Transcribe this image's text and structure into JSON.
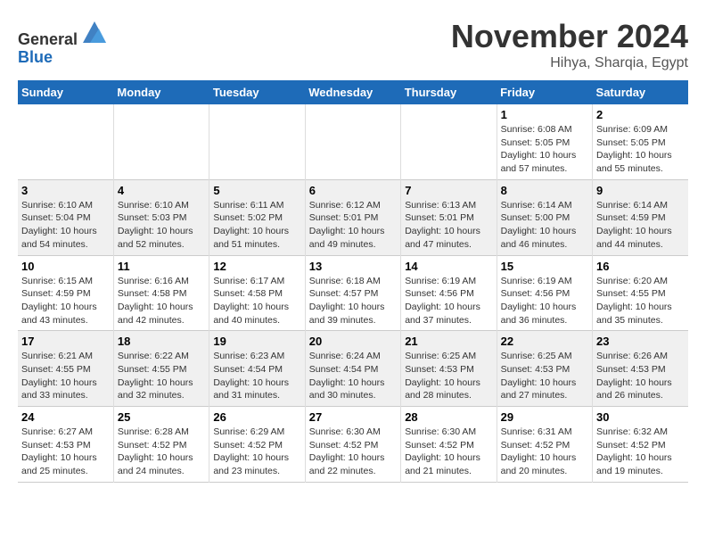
{
  "header": {
    "logo_line1": "General",
    "logo_line2": "Blue",
    "month": "November 2024",
    "location": "Hihya, Sharqia, Egypt"
  },
  "weekdays": [
    "Sunday",
    "Monday",
    "Tuesday",
    "Wednesday",
    "Thursday",
    "Friday",
    "Saturday"
  ],
  "weeks": [
    [
      {
        "day": "",
        "info": ""
      },
      {
        "day": "",
        "info": ""
      },
      {
        "day": "",
        "info": ""
      },
      {
        "day": "",
        "info": ""
      },
      {
        "day": "",
        "info": ""
      },
      {
        "day": "1",
        "info": "Sunrise: 6:08 AM\nSunset: 5:05 PM\nDaylight: 10 hours and 57 minutes."
      },
      {
        "day": "2",
        "info": "Sunrise: 6:09 AM\nSunset: 5:05 PM\nDaylight: 10 hours and 55 minutes."
      }
    ],
    [
      {
        "day": "3",
        "info": "Sunrise: 6:10 AM\nSunset: 5:04 PM\nDaylight: 10 hours and 54 minutes."
      },
      {
        "day": "4",
        "info": "Sunrise: 6:10 AM\nSunset: 5:03 PM\nDaylight: 10 hours and 52 minutes."
      },
      {
        "day": "5",
        "info": "Sunrise: 6:11 AM\nSunset: 5:02 PM\nDaylight: 10 hours and 51 minutes."
      },
      {
        "day": "6",
        "info": "Sunrise: 6:12 AM\nSunset: 5:01 PM\nDaylight: 10 hours and 49 minutes."
      },
      {
        "day": "7",
        "info": "Sunrise: 6:13 AM\nSunset: 5:01 PM\nDaylight: 10 hours and 47 minutes."
      },
      {
        "day": "8",
        "info": "Sunrise: 6:14 AM\nSunset: 5:00 PM\nDaylight: 10 hours and 46 minutes."
      },
      {
        "day": "9",
        "info": "Sunrise: 6:14 AM\nSunset: 4:59 PM\nDaylight: 10 hours and 44 minutes."
      }
    ],
    [
      {
        "day": "10",
        "info": "Sunrise: 6:15 AM\nSunset: 4:59 PM\nDaylight: 10 hours and 43 minutes."
      },
      {
        "day": "11",
        "info": "Sunrise: 6:16 AM\nSunset: 4:58 PM\nDaylight: 10 hours and 42 minutes."
      },
      {
        "day": "12",
        "info": "Sunrise: 6:17 AM\nSunset: 4:58 PM\nDaylight: 10 hours and 40 minutes."
      },
      {
        "day": "13",
        "info": "Sunrise: 6:18 AM\nSunset: 4:57 PM\nDaylight: 10 hours and 39 minutes."
      },
      {
        "day": "14",
        "info": "Sunrise: 6:19 AM\nSunset: 4:56 PM\nDaylight: 10 hours and 37 minutes."
      },
      {
        "day": "15",
        "info": "Sunrise: 6:19 AM\nSunset: 4:56 PM\nDaylight: 10 hours and 36 minutes."
      },
      {
        "day": "16",
        "info": "Sunrise: 6:20 AM\nSunset: 4:55 PM\nDaylight: 10 hours and 35 minutes."
      }
    ],
    [
      {
        "day": "17",
        "info": "Sunrise: 6:21 AM\nSunset: 4:55 PM\nDaylight: 10 hours and 33 minutes."
      },
      {
        "day": "18",
        "info": "Sunrise: 6:22 AM\nSunset: 4:55 PM\nDaylight: 10 hours and 32 minutes."
      },
      {
        "day": "19",
        "info": "Sunrise: 6:23 AM\nSunset: 4:54 PM\nDaylight: 10 hours and 31 minutes."
      },
      {
        "day": "20",
        "info": "Sunrise: 6:24 AM\nSunset: 4:54 PM\nDaylight: 10 hours and 30 minutes."
      },
      {
        "day": "21",
        "info": "Sunrise: 6:25 AM\nSunset: 4:53 PM\nDaylight: 10 hours and 28 minutes."
      },
      {
        "day": "22",
        "info": "Sunrise: 6:25 AM\nSunset: 4:53 PM\nDaylight: 10 hours and 27 minutes."
      },
      {
        "day": "23",
        "info": "Sunrise: 6:26 AM\nSunset: 4:53 PM\nDaylight: 10 hours and 26 minutes."
      }
    ],
    [
      {
        "day": "24",
        "info": "Sunrise: 6:27 AM\nSunset: 4:53 PM\nDaylight: 10 hours and 25 minutes."
      },
      {
        "day": "25",
        "info": "Sunrise: 6:28 AM\nSunset: 4:52 PM\nDaylight: 10 hours and 24 minutes."
      },
      {
        "day": "26",
        "info": "Sunrise: 6:29 AM\nSunset: 4:52 PM\nDaylight: 10 hours and 23 minutes."
      },
      {
        "day": "27",
        "info": "Sunrise: 6:30 AM\nSunset: 4:52 PM\nDaylight: 10 hours and 22 minutes."
      },
      {
        "day": "28",
        "info": "Sunrise: 6:30 AM\nSunset: 4:52 PM\nDaylight: 10 hours and 21 minutes."
      },
      {
        "day": "29",
        "info": "Sunrise: 6:31 AM\nSunset: 4:52 PM\nDaylight: 10 hours and 20 minutes."
      },
      {
        "day": "30",
        "info": "Sunrise: 6:32 AM\nSunset: 4:52 PM\nDaylight: 10 hours and 19 minutes."
      }
    ]
  ]
}
